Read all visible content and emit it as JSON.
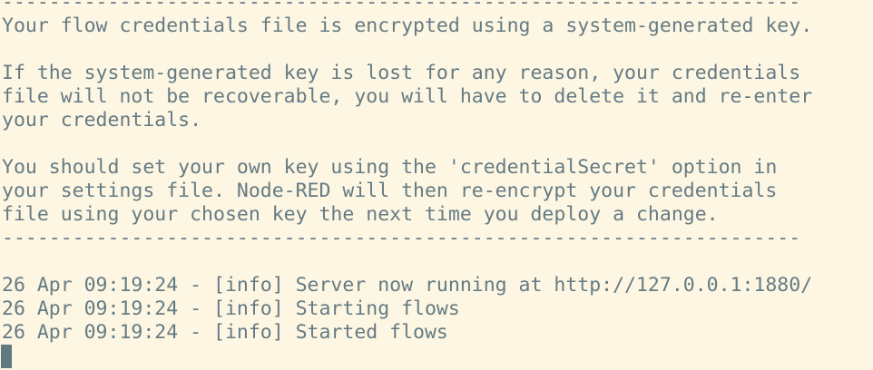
{
  "terminal": {
    "lines": [
      "--------------------------------------------------------------------",
      "Your flow credentials file is encrypted using a system-generated key.",
      "",
      "If the system-generated key is lost for any reason, your credentials",
      "file will not be recoverable, you will have to delete it and re-enter",
      "your credentials.",
      "",
      "You should set your own key using the 'credentialSecret' option in",
      "your settings file. Node-RED will then re-encrypt your credentials",
      "file using your chosen key the next time you deploy a change.",
      "--------------------------------------------------------------------",
      "",
      "26 Apr 09:19:24 - [info] Server now running at http://127.0.0.1:1880/",
      "26 Apr 09:19:24 - [info] Starting flows",
      "26 Apr 09:19:24 - [info] Started flows"
    ]
  },
  "colors": {
    "background": "#fdf6e3",
    "text": "#657b83",
    "cursor": "#5f7a80"
  }
}
